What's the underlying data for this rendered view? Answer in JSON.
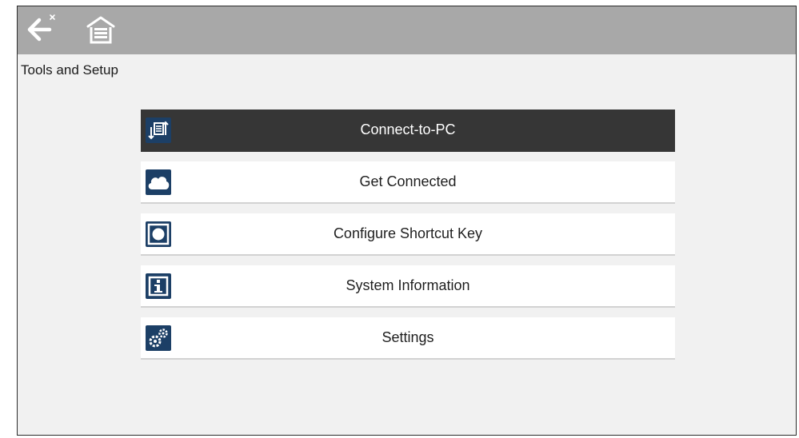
{
  "window": {
    "title": "Tools and Setup"
  },
  "topbar": {
    "back_icon": "back-arrow-icon",
    "home_icon": "garage-home-icon"
  },
  "menu": {
    "items": [
      {
        "label": "Connect-to-PC",
        "icon": "connect-to-pc-icon",
        "active": true
      },
      {
        "label": "Get Connected",
        "icon": "cloud-icon",
        "active": false
      },
      {
        "label": "Configure Shortcut Key",
        "icon": "shortcut-key-icon",
        "active": false
      },
      {
        "label": "System Information",
        "icon": "info-icon",
        "active": false
      },
      {
        "label": "Settings",
        "icon": "gears-icon",
        "active": false
      }
    ]
  },
  "colors": {
    "topbar": "#a8a8a8",
    "background": "#f1f1f1",
    "active_item": "#363636",
    "icon_background": "#1c3f66"
  }
}
